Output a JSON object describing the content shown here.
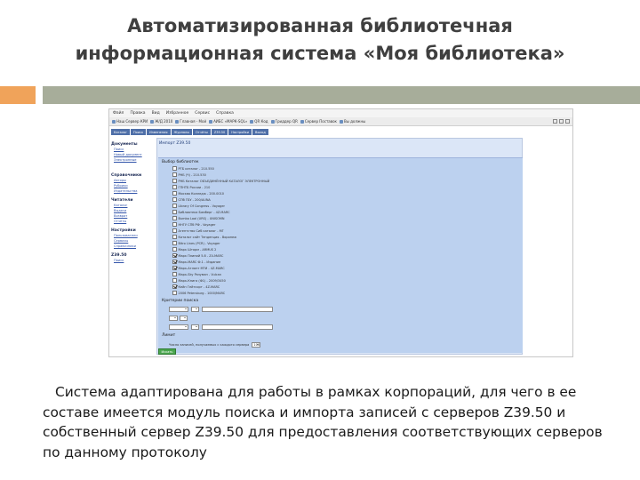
{
  "slide": {
    "title_lines": [
      "Автоматизированная библиотечная",
      "информационная система «Моя библиотека»"
    ],
    "body_lines": [
      "Система адаптирована для работы в рамках корпораций, для чего в ее",
      "составе имеется модуль поиска и импорта записей с серверов Z39.50 и",
      "собственный сервер Z39.50 для предоставления соответствующих серверов",
      "по данному протоколу"
    ],
    "colors": {
      "accent_orange": "#f0a35a",
      "accent_gray": "#a7ad9a"
    }
  },
  "screenshot": {
    "menu": [
      "Файл",
      "Правка",
      "Вид",
      "Избранное",
      "Сервис",
      "Справка"
    ],
    "bookmarks": [
      "Наш Сервер КРИ",
      "Ж/Д 2010",
      "Главная - Мой",
      "АИБС «МАРК-SQL»",
      "QR Код",
      "Гриддер QR",
      "Сервер Поставок",
      "Вы должны"
    ],
    "app_tabs": [
      "Каталог",
      "Поиск",
      "Изменения",
      "Журналы",
      "Отчёты",
      "Z39.50",
      "Настройки",
      "Выход"
    ],
    "sidebar": [
      {
        "head": "Документы",
        "links": [
          "Поиск",
          "Новый документ",
          "Электронные"
        ]
      },
      {
        "head": "Справочники",
        "links": [
          "Авторы",
          "Рубрики",
          "Издательства"
        ]
      },
      {
        "head": "Читатели",
        "links": [
          "Каталог",
          "Выдача",
          "Возврат",
          "Отчёты"
        ]
      },
      {
        "head": "Настройки",
        "links": [
          "Пользователи",
          "Сервисы",
          "Справочники"
        ]
      },
      {
        "head": "Z39.50",
        "links": [
          "Поиск"
        ]
      }
    ],
    "content_title": "Импорт Z39.50",
    "section_servers": "Выбор библиотек",
    "servers": [
      {
        "label": "РГБ каталог - 210.550",
        "checked": false
      },
      {
        "label": "РНБ (Ч) - 210.530",
        "checked": false
      },
      {
        "label": "РНБ Каталог ОБЪЕДИНЁННЫЙ КАТАЛОГ ЭЛЕКТРОННЫЙ",
        "checked": false
      },
      {
        "label": "ГПНТБ России - 210",
        "checked": false
      },
      {
        "label": "Москва Колледж - 200.0010",
        "checked": false
      },
      {
        "label": "СПб ГБУ - 200/AUNA",
        "checked": false
      },
      {
        "label": "Library Of Congress - Voyager",
        "checked": false
      },
      {
        "label": "Библиотека Бамберг - 4Z-MARC",
        "checked": false
      },
      {
        "label": "Bumbo Loal (URS) - UNISOMN",
        "checked": false
      },
      {
        "label": "ННГУ СПб РФ - Voyager",
        "checked": false
      },
      {
        "label": "Агентство Сиб каталог - МГ",
        "checked": false
      },
      {
        "label": "Каталог сайт Тенденция - Воронеж",
        "checked": false
      },
      {
        "label": "Bitro Lines (PCR) - Voyager",
        "checked": false
      },
      {
        "label": "Марк Шторм - ARMUS 2",
        "checked": false
      },
      {
        "label": "Марк Плиний 5.8 - Z4-MARC",
        "checked": true
      },
      {
        "label": "Марк-MARC Ф.1 - Издание",
        "checked": true
      },
      {
        "label": "Марк-Атлант МТИ - 4Z-MARC",
        "checked": true
      },
      {
        "label": "Марк-Sky Разуман - Vulcan",
        "checked": false
      },
      {
        "label": "Марк-Книга (Ф1) - 2009/3450",
        "checked": false
      },
      {
        "label": "Кейп Гейтсорт - 4Z-MARC",
        "checked": true
      },
      {
        "label": "2006 Petersburg - 1000/MARC",
        "checked": false
      }
    ],
    "section_criteria": "Критерии поиска",
    "section_limit": "Лимит",
    "limit_label": "Число записей, получаемых с каждого сервера",
    "limit_value": "100",
    "search_button": "Искать"
  }
}
